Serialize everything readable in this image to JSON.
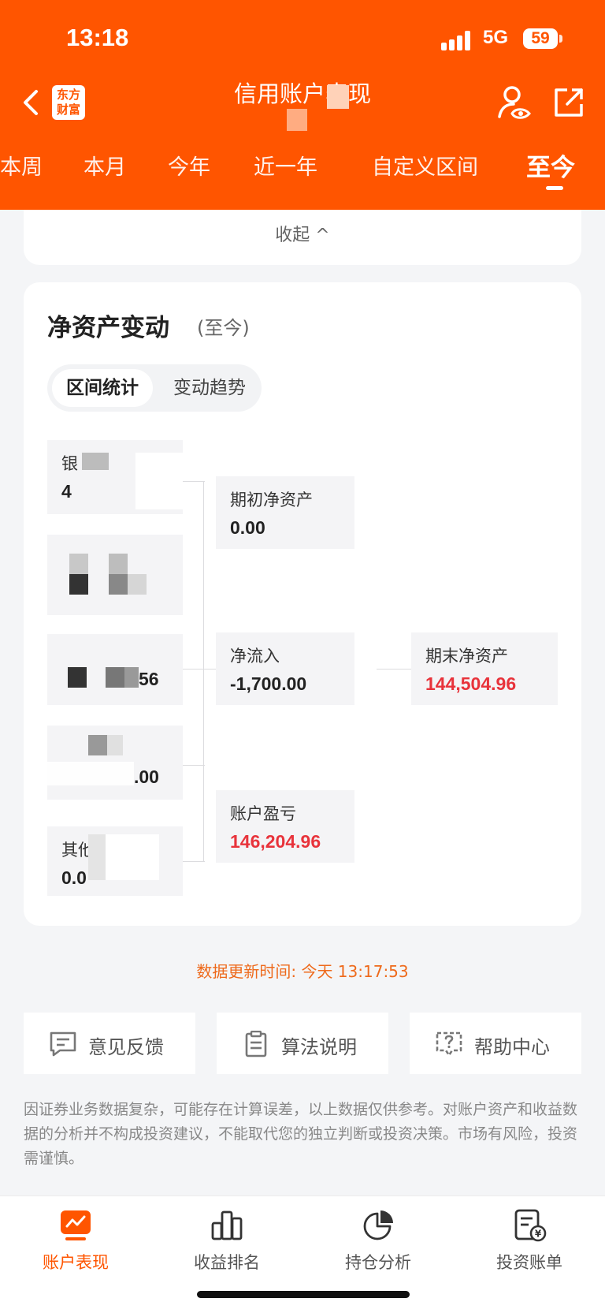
{
  "status_bar": {
    "time": "13:18",
    "network": "5G",
    "battery": "59"
  },
  "header": {
    "logo_text": "东方财富",
    "title": "信用账户表现",
    "tabs": [
      "本周",
      "本月",
      "今年",
      "近一年",
      "自定义区间",
      "至今"
    ],
    "active_tab": "至今"
  },
  "collapse_label": "收起 ^",
  "net_asset_card": {
    "title": "净资产变动",
    "subtitle": "(至今)",
    "segments": [
      "区间统计",
      "变动趋势"
    ],
    "left_items": [
      {
        "label": "银",
        "value": "4"
      },
      {
        "label": "",
        "value": ""
      },
      {
        "label": "",
        "value": "56"
      },
      {
        "label": "",
        "value": ".00"
      },
      {
        "label": "其他",
        "value": "0.0"
      }
    ],
    "opening": {
      "label": "期初净资产",
      "value": "0.00"
    },
    "net_inflow": {
      "label": "净流入",
      "value": "-1,700.00"
    },
    "profit": {
      "label": "账户盈亏",
      "value": "146,204.96"
    },
    "closing": {
      "label": "期末净资产",
      "value": "144,504.96"
    }
  },
  "update_time": "数据更新时间: 今天 13:17:53",
  "footer_buttons": [
    {
      "label": "意见反馈",
      "icon": "feedback-icon"
    },
    {
      "label": "算法说明",
      "icon": "clipboard-icon"
    },
    {
      "label": "帮助中心",
      "icon": "help-icon"
    }
  ],
  "disclaimer": "因证券业务数据复杂，可能存在计算误差，以上数据仅供参考。对账户资产和收益数据的分析并不构成投资建议，不能取代您的独立判断或投资决策。市场有风险，投资需谨慎。",
  "bottom_nav": [
    {
      "label": "账户表现",
      "icon": "account-performance-icon",
      "active": true
    },
    {
      "label": "收益排名",
      "icon": "ranking-icon"
    },
    {
      "label": "持仓分析",
      "icon": "pie-chart-icon"
    },
    {
      "label": "投资账单",
      "icon": "bill-icon"
    }
  ],
  "colors": {
    "brand": "#ff5500",
    "loss_red": "#e8333b",
    "update_text": "#ee6a1c"
  }
}
